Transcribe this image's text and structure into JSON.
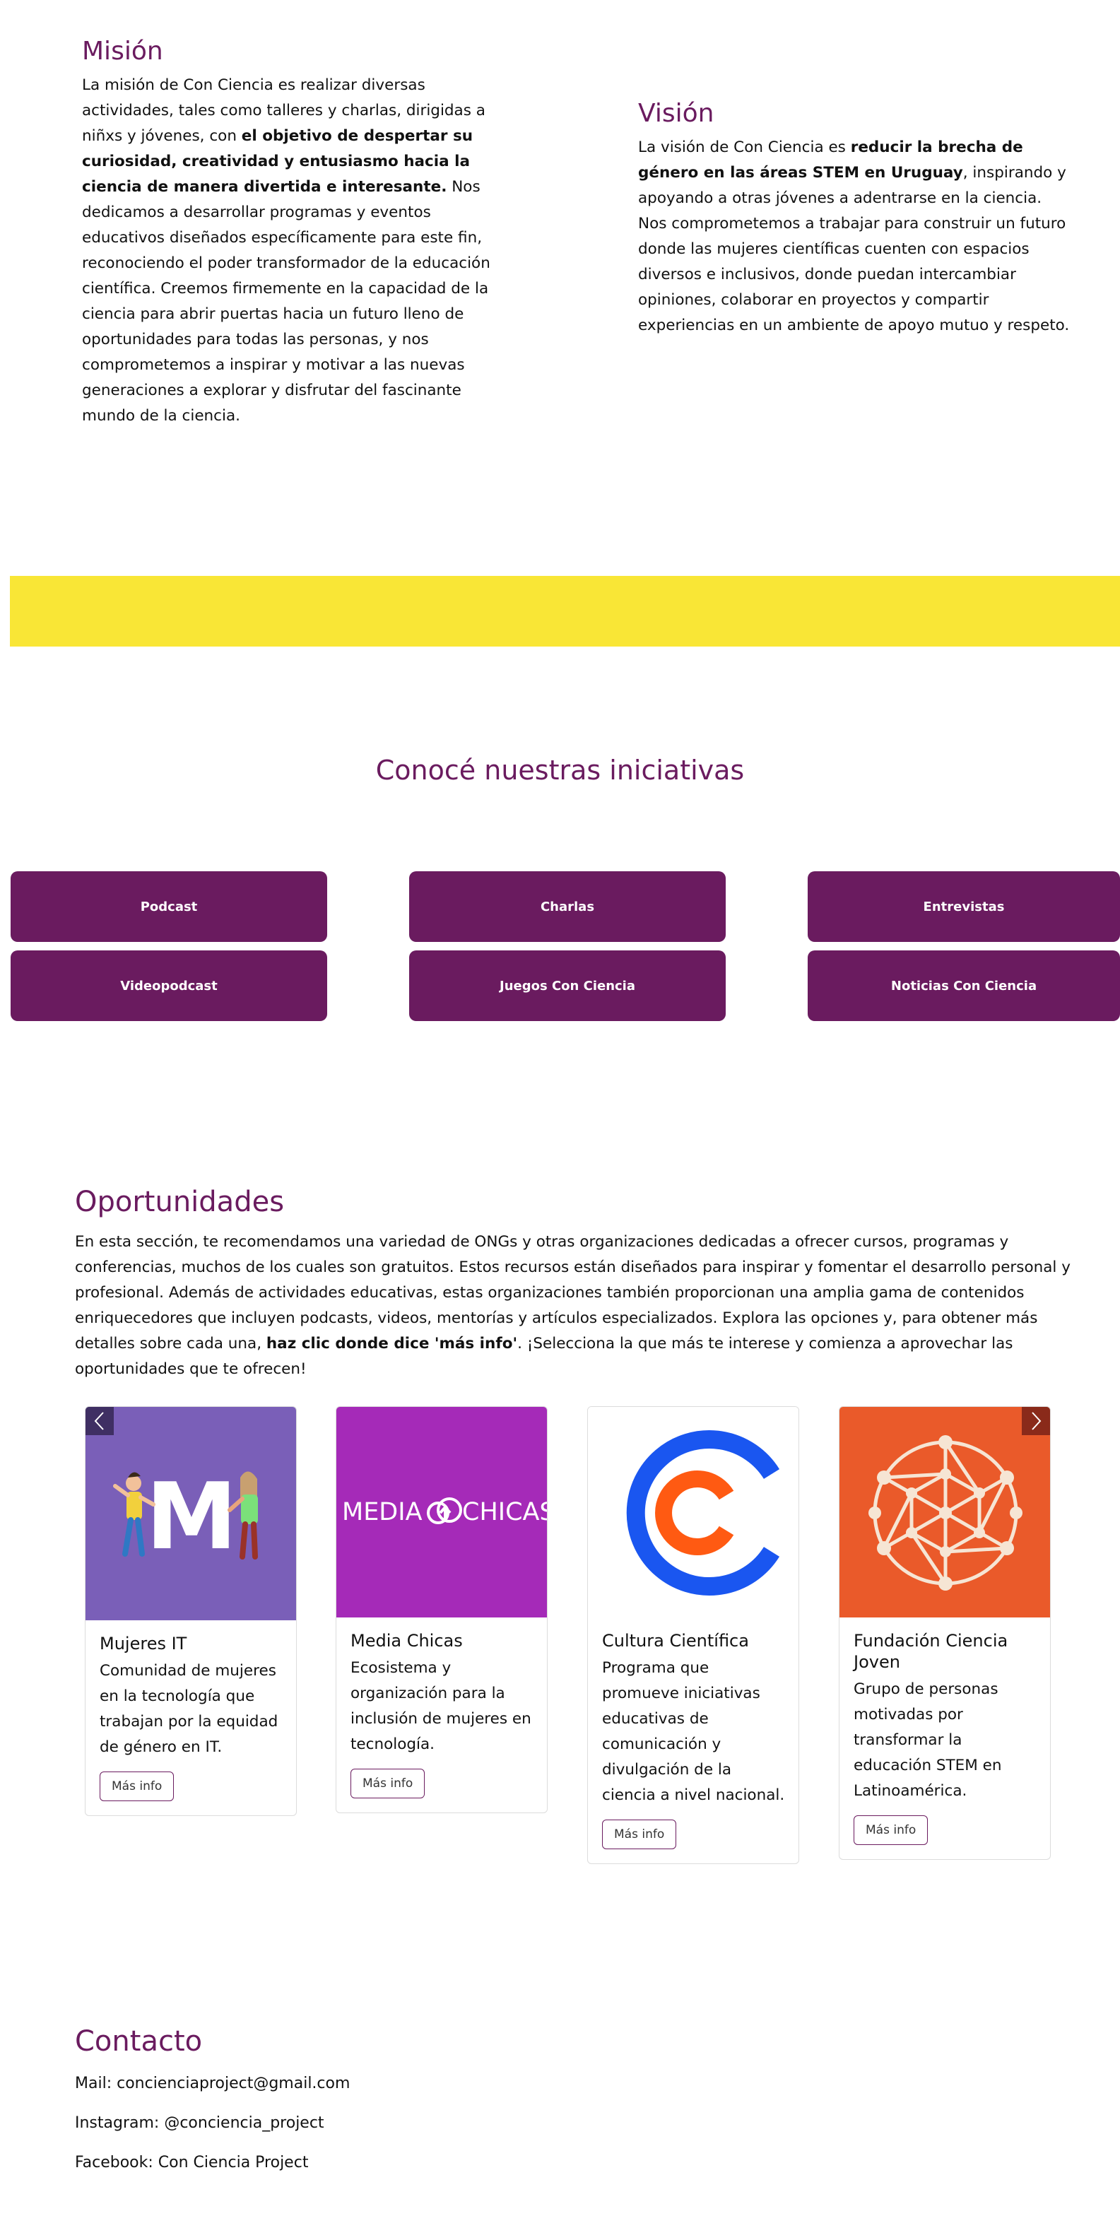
{
  "mision": {
    "title": "Misión",
    "p1": "La misión de Con Ciencia es realizar diversas actividades, tales como talleres y charlas, dirigidas a niñxs y jóvenes, con ",
    "p1_bold": "el objetivo de despertar su curiosidad, creatividad y entusiasmo hacia la ciencia de manera divertida e interesante.",
    "p2": " Nos dedicamos a desarrollar programas y eventos educativos diseñados específicamente para este fin, reconociendo el poder transformador de la educación científica. Creemos firmemente en la capacidad de la ciencia para abrir puertas hacia un futuro lleno de oportunidades para todas las personas, y nos comprometemos a inspirar y motivar a las nuevas generaciones a explorar y disfrutar del fascinante mundo de la ciencia."
  },
  "vision": {
    "title": "Visión",
    "p1": "La visión de Con Ciencia es ",
    "p1_bold": "reducir la brecha de género en las áreas STEM en Uruguay",
    "p2": ", inspirando y apoyando a otras jóvenes a adentrarse en la ciencia. Nos comprometemos a trabajar para construir un futuro donde las mujeres científicas cuenten con espacios diversos e inclusivos, donde puedan intercambiar opiniones, colaborar en proyectos y compartir experiencias en un ambiente de apoyo mutuo y respeto."
  },
  "iniciativas": {
    "title": "Conocé nuestras iniciativas",
    "buttons": [
      "Podcast",
      "Charlas",
      "Entrevistas",
      "Videopodcast",
      "Juegos Con Ciencia",
      "Noticias Con Ciencia"
    ]
  },
  "oportunidades": {
    "title": "Oportunidades",
    "p1": "En esta sección, te recomendamos una variedad de ONGs y otras organizaciones dedicadas a ofrecer cursos, programas y conferencias, muchos de los cuales son gratuitos. Estos recursos están diseñados para inspirar y fomentar el desarrollo personal y profesional. Además de actividades educativas, estas organizaciones también proporcionan una amplia gama de contenidos enriquecedores que incluyen podcasts, videos, mentorías y artículos especializados. Explora las opciones y, para obtener más detalles sobre cada una, ",
    "p1_bold": "haz clic donde dice 'más info'",
    "p2": ". ¡Selecciona la que más te interese y comienza a aprovechar las oportunidades que te ofrecen!",
    "cards": [
      {
        "title": "Mujeres IT",
        "desc": "Comunidad de mujeres en la tecnología que trabajan por la equidad de género en IT.",
        "button": "Más info",
        "image_color": "#7a5fb8"
      },
      {
        "title": "Media Chicas",
        "desc": "Ecosistema y organización para la inclusión de mujeres en tecnología.",
        "button": "Más info",
        "image_color": "#a52ab8",
        "logo_text_left": "MEDIA",
        "logo_text_right": "CHICAS"
      },
      {
        "title": "Cultura Científica",
        "desc": "Programa que promueve iniciativas educativas de comunicación y divulgación de la ciencia a nivel nacional.",
        "button": "Más info",
        "image_color": "#ffffff"
      },
      {
        "title": "Fundación Ciencia Joven",
        "desc": "Grupo de personas motivadas por transformar la educación STEM en Latinoamérica.",
        "button": "Más info",
        "image_color": "#ea5a2a"
      }
    ],
    "prev_icon": "chevron-left-icon",
    "next_icon": "chevron-right-icon"
  },
  "contacto": {
    "title": "Contacto",
    "mail": "Mail: concienciaproject@gmail.com",
    "instagram": "Instagram: @conciencia_project",
    "facebook": "Facebook: Con Ciencia Project"
  },
  "colors": {
    "brand_purple": "#6a1b5f",
    "yellow": "#f9e636"
  }
}
